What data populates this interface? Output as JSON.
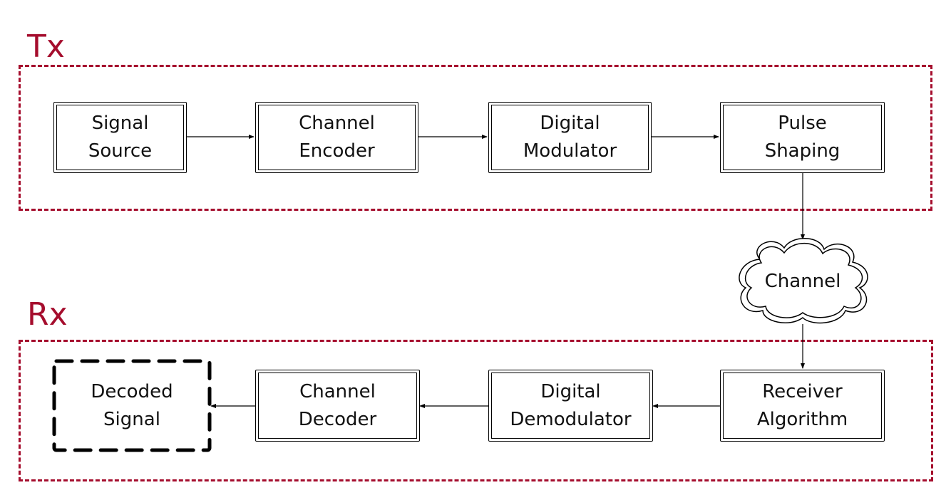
{
  "diagram": {
    "groups": {
      "tx": {
        "label": "Tx",
        "color": "#a50d2d"
      },
      "rx": {
        "label": "Rx",
        "color": "#a50d2d"
      }
    },
    "tx_blocks": [
      {
        "id": "signal-source",
        "label": "Signal\nSource"
      },
      {
        "id": "channel-encoder",
        "label": "Channel\nEncoder"
      },
      {
        "id": "digital-modulator",
        "label": "Digital\nModulator"
      },
      {
        "id": "pulse-shaping",
        "label": "Pulse\nShaping"
      }
    ],
    "channel": {
      "label": "Channel",
      "shape": "cloud-icon"
    },
    "rx_blocks": [
      {
        "id": "receiver-algorithm",
        "label": "Receiver\nAlgorithm"
      },
      {
        "id": "digital-demodulator",
        "label": "Digital\nDemodulator"
      },
      {
        "id": "channel-decoder",
        "label": "Channel\nDecoder"
      },
      {
        "id": "decoded-signal",
        "label": "Decoded\nSignal",
        "style": "dashed"
      }
    ],
    "edges": [
      {
        "from": "signal-source",
        "to": "channel-encoder"
      },
      {
        "from": "channel-encoder",
        "to": "digital-modulator"
      },
      {
        "from": "digital-modulator",
        "to": "pulse-shaping"
      },
      {
        "from": "pulse-shaping",
        "to": "channel"
      },
      {
        "from": "channel",
        "to": "receiver-algorithm"
      },
      {
        "from": "receiver-algorithm",
        "to": "digital-demodulator"
      },
      {
        "from": "digital-demodulator",
        "to": "channel-decoder"
      },
      {
        "from": "channel-decoder",
        "to": "decoded-signal"
      }
    ]
  }
}
